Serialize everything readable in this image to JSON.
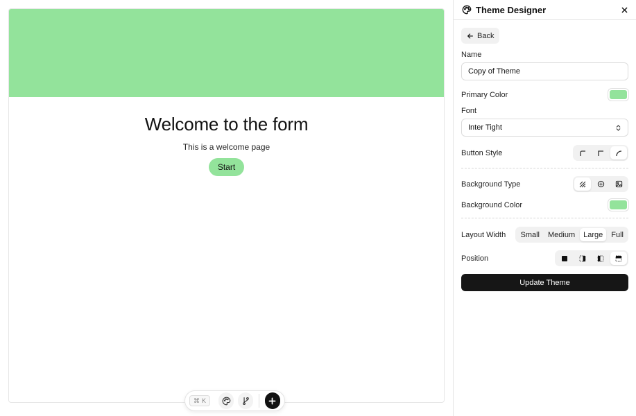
{
  "form": {
    "title": "Welcome to the form",
    "subtitle": "This is a welcome page",
    "start_label": "Start"
  },
  "toolbar": {
    "shortcut_symbol": "⌘",
    "shortcut_key": "K"
  },
  "panel": {
    "title": "Theme Designer",
    "back_label": "Back",
    "name_label": "Name",
    "name_value": "Copy of Theme",
    "primary_color_label": "Primary Color",
    "primary_color": "#93e39b",
    "font_label": "Font",
    "font_value": "Inter Tight",
    "button_style_label": "Button Style",
    "button_style_options": [
      "square-corner-icon",
      "sharp-corner-icon",
      "rounded-corner-icon"
    ],
    "button_style_selected": "rounded-corner-icon",
    "background_type_label": "Background Type",
    "background_type_options": [
      "pattern-icon",
      "gradient-icon",
      "image-icon"
    ],
    "background_type_selected": "pattern-icon",
    "background_color_label": "Background Color",
    "background_color": "#93e39b",
    "layout_width_label": "Layout Width",
    "layout_width_options": [
      "Small",
      "Medium",
      "Large",
      "Full"
    ],
    "layout_width_selected": "Large",
    "position_label": "Position",
    "position_options": [
      "position-full-icon",
      "position-right-icon",
      "position-left-icon",
      "position-top-icon"
    ],
    "position_selected": "position-top-icon",
    "update_label": "Update Theme"
  },
  "colors": {
    "accent": "#93e39b",
    "button_dark": "#161616"
  }
}
